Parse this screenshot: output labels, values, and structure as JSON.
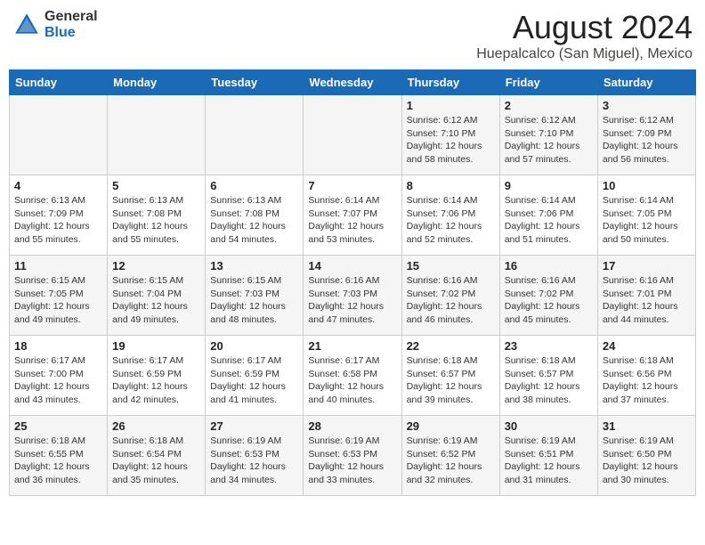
{
  "header": {
    "logo_general": "General",
    "logo_blue": "Blue",
    "title": "August 2024",
    "location": "Huepalcalco (San Miguel), Mexico"
  },
  "weekdays": [
    "Sunday",
    "Monday",
    "Tuesday",
    "Wednesday",
    "Thursday",
    "Friday",
    "Saturday"
  ],
  "weeks": [
    [
      {
        "day": "",
        "info": ""
      },
      {
        "day": "",
        "info": ""
      },
      {
        "day": "",
        "info": ""
      },
      {
        "day": "",
        "info": ""
      },
      {
        "day": "1",
        "info": "Sunrise: 6:12 AM\nSunset: 7:10 PM\nDaylight: 12 hours\nand 58 minutes."
      },
      {
        "day": "2",
        "info": "Sunrise: 6:12 AM\nSunset: 7:10 PM\nDaylight: 12 hours\nand 57 minutes."
      },
      {
        "day": "3",
        "info": "Sunrise: 6:12 AM\nSunset: 7:09 PM\nDaylight: 12 hours\nand 56 minutes."
      }
    ],
    [
      {
        "day": "4",
        "info": "Sunrise: 6:13 AM\nSunset: 7:09 PM\nDaylight: 12 hours\nand 55 minutes."
      },
      {
        "day": "5",
        "info": "Sunrise: 6:13 AM\nSunset: 7:08 PM\nDaylight: 12 hours\nand 55 minutes."
      },
      {
        "day": "6",
        "info": "Sunrise: 6:13 AM\nSunset: 7:08 PM\nDaylight: 12 hours\nand 54 minutes."
      },
      {
        "day": "7",
        "info": "Sunrise: 6:14 AM\nSunset: 7:07 PM\nDaylight: 12 hours\nand 53 minutes."
      },
      {
        "day": "8",
        "info": "Sunrise: 6:14 AM\nSunset: 7:06 PM\nDaylight: 12 hours\nand 52 minutes."
      },
      {
        "day": "9",
        "info": "Sunrise: 6:14 AM\nSunset: 7:06 PM\nDaylight: 12 hours\nand 51 minutes."
      },
      {
        "day": "10",
        "info": "Sunrise: 6:14 AM\nSunset: 7:05 PM\nDaylight: 12 hours\nand 50 minutes."
      }
    ],
    [
      {
        "day": "11",
        "info": "Sunrise: 6:15 AM\nSunset: 7:05 PM\nDaylight: 12 hours\nand 49 minutes."
      },
      {
        "day": "12",
        "info": "Sunrise: 6:15 AM\nSunset: 7:04 PM\nDaylight: 12 hours\nand 49 minutes."
      },
      {
        "day": "13",
        "info": "Sunrise: 6:15 AM\nSunset: 7:03 PM\nDaylight: 12 hours\nand 48 minutes."
      },
      {
        "day": "14",
        "info": "Sunrise: 6:16 AM\nSunset: 7:03 PM\nDaylight: 12 hours\nand 47 minutes."
      },
      {
        "day": "15",
        "info": "Sunrise: 6:16 AM\nSunset: 7:02 PM\nDaylight: 12 hours\nand 46 minutes."
      },
      {
        "day": "16",
        "info": "Sunrise: 6:16 AM\nSunset: 7:02 PM\nDaylight: 12 hours\nand 45 minutes."
      },
      {
        "day": "17",
        "info": "Sunrise: 6:16 AM\nSunset: 7:01 PM\nDaylight: 12 hours\nand 44 minutes."
      }
    ],
    [
      {
        "day": "18",
        "info": "Sunrise: 6:17 AM\nSunset: 7:00 PM\nDaylight: 12 hours\nand 43 minutes."
      },
      {
        "day": "19",
        "info": "Sunrise: 6:17 AM\nSunset: 6:59 PM\nDaylight: 12 hours\nand 42 minutes."
      },
      {
        "day": "20",
        "info": "Sunrise: 6:17 AM\nSunset: 6:59 PM\nDaylight: 12 hours\nand 41 minutes."
      },
      {
        "day": "21",
        "info": "Sunrise: 6:17 AM\nSunset: 6:58 PM\nDaylight: 12 hours\nand 40 minutes."
      },
      {
        "day": "22",
        "info": "Sunrise: 6:18 AM\nSunset: 6:57 PM\nDaylight: 12 hours\nand 39 minutes."
      },
      {
        "day": "23",
        "info": "Sunrise: 6:18 AM\nSunset: 6:57 PM\nDaylight: 12 hours\nand 38 minutes."
      },
      {
        "day": "24",
        "info": "Sunrise: 6:18 AM\nSunset: 6:56 PM\nDaylight: 12 hours\nand 37 minutes."
      }
    ],
    [
      {
        "day": "25",
        "info": "Sunrise: 6:18 AM\nSunset: 6:55 PM\nDaylight: 12 hours\nand 36 minutes."
      },
      {
        "day": "26",
        "info": "Sunrise: 6:18 AM\nSunset: 6:54 PM\nDaylight: 12 hours\nand 35 minutes."
      },
      {
        "day": "27",
        "info": "Sunrise: 6:19 AM\nSunset: 6:53 PM\nDaylight: 12 hours\nand 34 minutes."
      },
      {
        "day": "28",
        "info": "Sunrise: 6:19 AM\nSunset: 6:53 PM\nDaylight: 12 hours\nand 33 minutes."
      },
      {
        "day": "29",
        "info": "Sunrise: 6:19 AM\nSunset: 6:52 PM\nDaylight: 12 hours\nand 32 minutes."
      },
      {
        "day": "30",
        "info": "Sunrise: 6:19 AM\nSunset: 6:51 PM\nDaylight: 12 hours\nand 31 minutes."
      },
      {
        "day": "31",
        "info": "Sunrise: 6:19 AM\nSunset: 6:50 PM\nDaylight: 12 hours\nand 30 minutes."
      }
    ]
  ]
}
